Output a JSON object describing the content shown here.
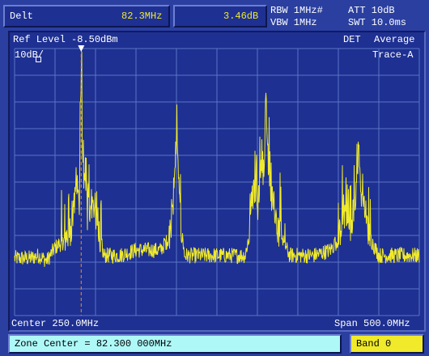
{
  "header": {
    "mode_label": "Delt",
    "marker_freq": "82.3MHz",
    "marker_level": "3.46dB",
    "rbw": "RBW 1MHz#",
    "vbw": "VBW 1MHz",
    "att": "ATT 10dB",
    "swt": "SWT 10.0ms"
  },
  "screen": {
    "ref_level": "Ref Level -8.50dBm",
    "detector": "DET",
    "detector_mode": "Average",
    "scale": "10dB/",
    "trace": "Trace-A",
    "center": "Center 250.0MHz",
    "span": "Span 500.0MHz"
  },
  "footer": {
    "zone_center": "Zone Center = 82.300 000MHz",
    "band": "Band 0"
  },
  "colors": {
    "background": "#2a3fa0",
    "grid": "#5b74c4",
    "trace": "#f0ea2a",
    "marker": "#ff8c00",
    "input_bg": "#aef8f8",
    "band_bg": "#f0ea2a"
  },
  "chart_data": {
    "type": "line",
    "title": "",
    "xlabel": "",
    "ylabel": "",
    "x_unit": "MHz",
    "y_unit": "dBm",
    "xlim": [
      0,
      500
    ],
    "ylim": [
      -108.5,
      -8.5
    ],
    "grid": true,
    "marker": {
      "x": 82.3,
      "y": -12
    },
    "series": [
      {
        "name": "Trace-A",
        "points": [
          [
            0,
            -87
          ],
          [
            20,
            -87
          ],
          [
            30,
            -86
          ],
          [
            40,
            -88
          ],
          [
            50,
            -83
          ],
          [
            60,
            -81
          ],
          [
            70,
            -76
          ],
          [
            75,
            -65
          ],
          [
            78,
            -58
          ],
          [
            80,
            -70
          ],
          [
            82.3,
            -12
          ],
          [
            85,
            -66
          ],
          [
            88,
            -56
          ],
          [
            90,
            -72
          ],
          [
            95,
            -66
          ],
          [
            100,
            -72
          ],
          [
            105,
            -78
          ],
          [
            110,
            -86
          ],
          [
            130,
            -86
          ],
          [
            140,
            -85
          ],
          [
            150,
            -84
          ],
          [
            180,
            -84
          ],
          [
            190,
            -80
          ],
          [
            196,
            -70
          ],
          [
            198,
            -54
          ],
          [
            200,
            -41
          ],
          [
            202,
            -55
          ],
          [
            205,
            -74
          ],
          [
            210,
            -86
          ],
          [
            260,
            -86
          ],
          [
            285,
            -86
          ],
          [
            290,
            -78
          ],
          [
            293,
            -65
          ],
          [
            297,
            -60
          ],
          [
            300,
            -69
          ],
          [
            303,
            -56
          ],
          [
            306,
            -50
          ],
          [
            308,
            -62
          ],
          [
            310,
            -28
          ],
          [
            313,
            -50
          ],
          [
            316,
            -62
          ],
          [
            320,
            -66
          ],
          [
            325,
            -76
          ],
          [
            330,
            -80
          ],
          [
            340,
            -86
          ],
          [
            370,
            -86
          ],
          [
            390,
            -84
          ],
          [
            400,
            -80
          ],
          [
            405,
            -74
          ],
          [
            410,
            -70
          ],
          [
            415,
            -78
          ],
          [
            420,
            -65
          ],
          [
            423,
            -60
          ],
          [
            425,
            -45
          ],
          [
            428,
            -62
          ],
          [
            432,
            -70
          ],
          [
            440,
            -80
          ],
          [
            450,
            -86
          ],
          [
            480,
            -86
          ],
          [
            500,
            -86
          ]
        ]
      }
    ]
  }
}
